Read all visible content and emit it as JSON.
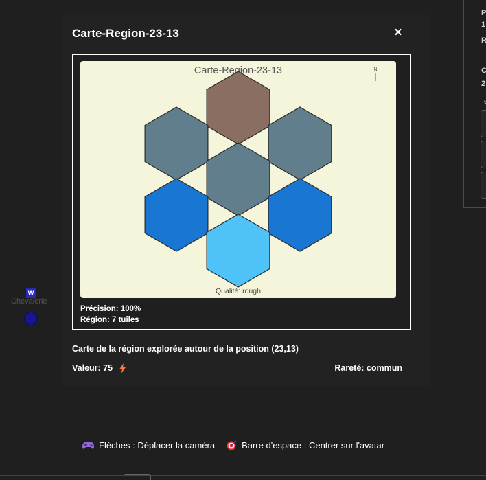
{
  "background": {
    "side_labels": [
      "P",
      "1",
      "R",
      "C",
      "2",
      "e"
    ],
    "character": {
      "badge": "W",
      "name": "Chevalerie"
    }
  },
  "modal": {
    "title": "Carte-Region-23-13",
    "close_label": "×",
    "map": {
      "title": "Carte-Region-23-13",
      "compass": "N",
      "quality": "Qualité: rough",
      "colors": {
        "background": "#f5f5dc",
        "slate": "#617e8c",
        "brown": "#8b6e62",
        "blue": "#1976d2",
        "light_blue": "#4fc3f7"
      },
      "tiles": [
        {
          "color": "#8b6e62"
        },
        {
          "color": "#617e8c"
        },
        {
          "color": "#617e8c"
        },
        {
          "color": "#617e8c"
        },
        {
          "color": "#1976d2"
        },
        {
          "color": "#1976d2"
        },
        {
          "color": "#4fc3f7"
        }
      ]
    },
    "precision": "Précision: 100%",
    "region": "Région: 7 tuiles",
    "description": "Carte de la région explorée autour de la position (23,13)",
    "value": "Valeur: 75",
    "rarity": "Rareté: commun",
    "accent_color": "#ff7043"
  },
  "hints": {
    "camera": "Flèches : Déplacer la caméra",
    "center": "Barre d'espace : Centrer sur l'avatar"
  }
}
